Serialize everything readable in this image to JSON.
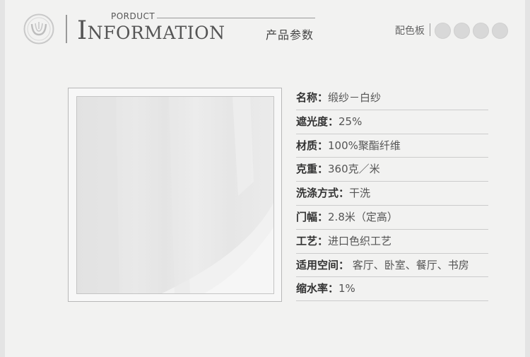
{
  "header": {
    "eyebrow": "PORDUCT",
    "title": "Information",
    "subtitle": "产品参数",
    "palette_label": "配色板",
    "swatches": [
      "#d8d8d8",
      "#d8d8d8",
      "#d8d8d8",
      "#d8d8d8"
    ]
  },
  "specs": [
    {
      "label": "名称：",
      "value": "缎纱－白纱"
    },
    {
      "label": "遮光度：",
      "value": "25%"
    },
    {
      "label": "材质：",
      "value": "100%聚酯纤维"
    },
    {
      "label": "克重：",
      "value": "360克／米"
    },
    {
      "label": "洗涤方式：",
      "value": "干洗"
    },
    {
      "label": "门幅：",
      "value": "2.8米（定高）"
    },
    {
      "label": "工艺：",
      "value": "进口色织工艺"
    },
    {
      "label": "适用空间：",
      "value": " 客厅、卧室、餐厅、书房"
    },
    {
      "label": "缩水率：",
      "value": "1%"
    }
  ]
}
